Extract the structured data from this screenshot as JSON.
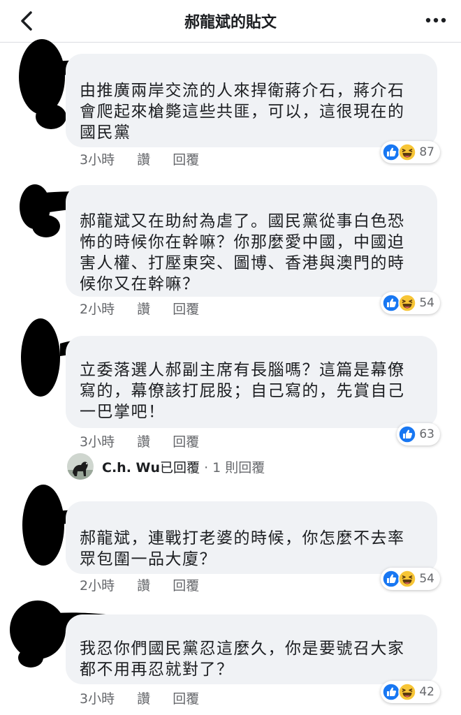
{
  "header": {
    "title": "郝龍斌的貼文"
  },
  "comments": [
    {
      "text": "由推廣兩岸交流的人來捍衛蔣介石，蔣介石\n會爬起來槍斃這些共匪，可以，這很現在的\n國民黨",
      "time": "3小時",
      "like_label": "讚",
      "reply_label": "回覆",
      "reaction_count": "87"
    },
    {
      "text": "郝龍斌又在助紂為虐了。國民黨從事白色恐\n怖的時候你在幹嘛？你那麼愛中國，中國迫\n害人權、打壓東突、圖博、香港與澳門的時\n候你又在幹嘛？",
      "time": "2小時",
      "like_label": "讚",
      "reply_label": "回覆",
      "reaction_count": "54"
    },
    {
      "text": "立委落選人郝副主席有長腦嗎？這篇是幕僚\n寫的，幕僚該打屁股；自己寫的，先賞自己\n一巴掌吧！",
      "time": "3小時",
      "like_label": "讚",
      "reply_label": "回覆",
      "reaction_count": "63"
    },
    {
      "text": "郝龍斌，連戰打老婆的時候，你怎麼不去率\n眾包圍一品大廈？",
      "time": "2小時",
      "like_label": "讚",
      "reply_label": "回覆",
      "reaction_count": "54"
    },
    {
      "text": "我忍你們國民黨忍這麼久，你是要號召大家\n都不用再忍就對了？",
      "time": "3小時",
      "like_label": "讚",
      "reply_label": "回覆",
      "reaction_count": "42"
    }
  ],
  "reply_summary": {
    "name": "C.h. Wu",
    "action": "已回覆",
    "separator": " · ",
    "count": "1 則回覆"
  },
  "colors": {
    "like_blue": "#1877f2",
    "haha_yellow": "#f7c536",
    "bubble": "#f0f2f5",
    "meta_gray": "#65676b"
  },
  "icons": {
    "back": "chevron-left-icon",
    "more": "more-dots-icon",
    "like": "like-reaction-icon",
    "haha": "haha-reaction-icon"
  }
}
